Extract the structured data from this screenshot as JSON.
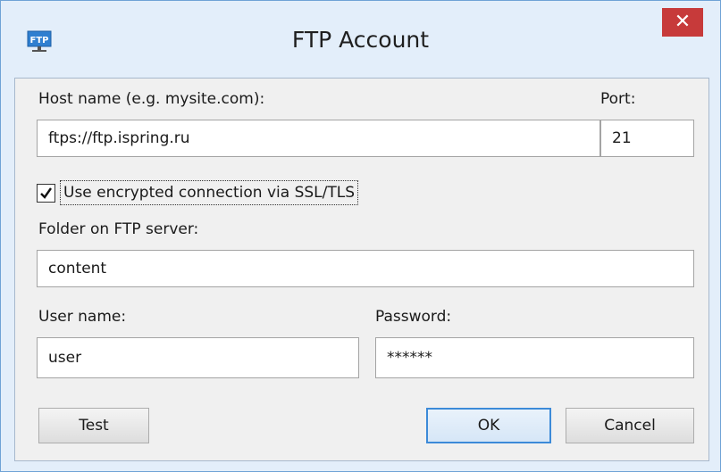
{
  "window": {
    "title": "FTP Account",
    "icon": "ftp-icon",
    "icon_text": "FTP",
    "close_glyph": "✕"
  },
  "form": {
    "host": {
      "label": "Host name (e.g. mysite.com):",
      "value": "ftps://ftp.ispring.ru"
    },
    "port": {
      "label": "Port:",
      "value": "21"
    },
    "ssl": {
      "label": "Use encrypted connection via SSL/TLS",
      "checked": true
    },
    "folder": {
      "label": "Folder on FTP server:",
      "value": "content"
    },
    "username": {
      "label": "User name:",
      "value": "user"
    },
    "password": {
      "label": "Password:",
      "value": "******"
    }
  },
  "buttons": {
    "test": "Test",
    "ok": "OK",
    "cancel": "Cancel"
  },
  "colors": {
    "close_button": "#c73a3a",
    "default_button_border": "#3c8ad8",
    "window_frame": "#e3eefa"
  }
}
